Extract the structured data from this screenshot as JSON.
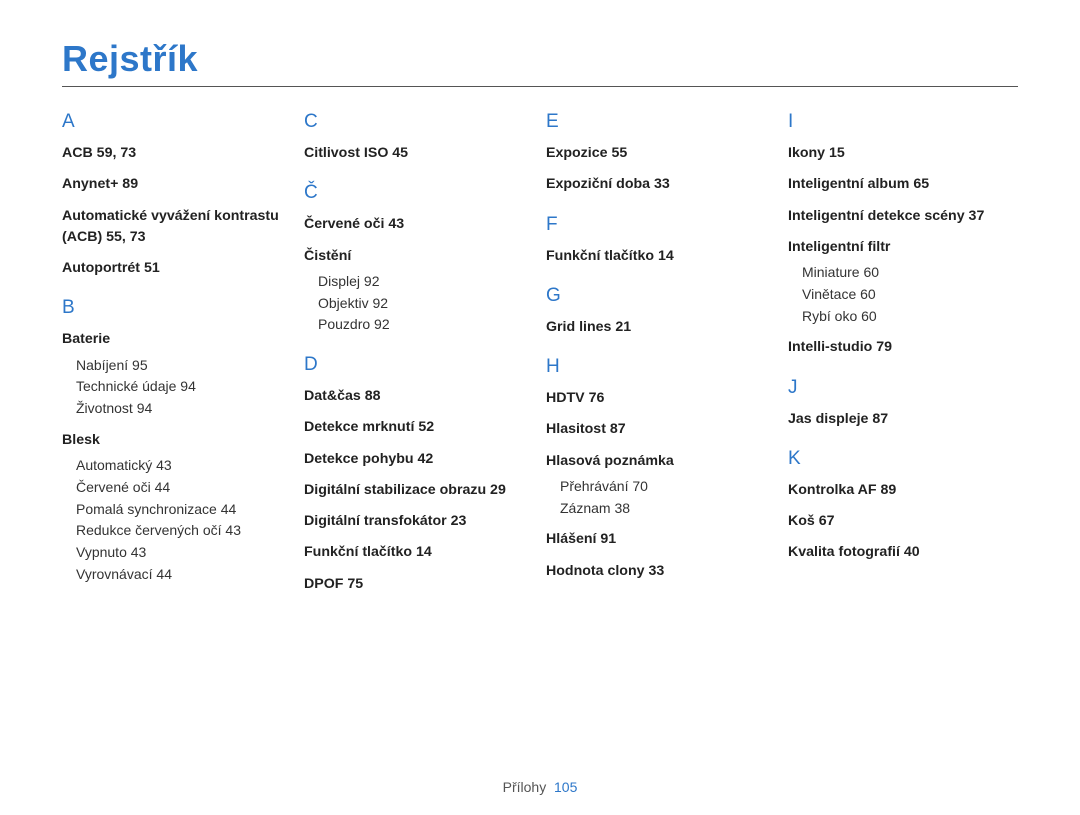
{
  "title": "Rejstřík",
  "footer": {
    "label": "Přílohy",
    "page": "105"
  },
  "col1": {
    "A": {
      "letter": "A",
      "e1": "ACB  59, 73",
      "e2": "Anynet+  89",
      "e3": "Automatické vyvážení kontrastu (ACB)  55, 73",
      "e4": "Autoportrét  51"
    },
    "B": {
      "letter": "B",
      "e1": "Baterie",
      "e1s1": "Nabíjení  95",
      "e1s2": "Technické údaje  94",
      "e1s3": "Životnost  94",
      "e2": "Blesk",
      "e2s1": "Automatický 43",
      "e2s2": "Červené oči 44",
      "e2s3": "Pomalá synchronizace 44",
      "e2s4": "Redukce červených očí 43",
      "e2s5": "Vypnuto 43",
      "e2s6": "Vyrovnávací 44"
    }
  },
  "col2": {
    "C": {
      "letter": "C",
      "e1": "Citlivost ISO  45"
    },
    "Cv": {
      "letter": "Č",
      "e1": "Červené oči  43",
      "e2": "Čistění",
      "e2s1": "Displej  92",
      "e2s2": "Objektiv  92",
      "e2s3": "Pouzdro  92"
    },
    "D": {
      "letter": "D",
      "e1": "Dat&čas  88",
      "e2": "Detekce mrknutí  52",
      "e3": "Detekce pohybu  42",
      "e4": "Digitální stabilizace obrazu  29",
      "e5": "Digitální transfokátor  23",
      "e6": "Funkční tlačítko 14",
      "e7": "DPOF  75"
    }
  },
  "col3": {
    "E": {
      "letter": "E",
      "e1": "Expozice  55",
      "e2": "Expoziční doba  33"
    },
    "F": {
      "letter": "F",
      "e1": "Funkční tlačítko 14"
    },
    "G": {
      "letter": "G",
      "e1": "Grid lines  21"
    },
    "H": {
      "letter": "H",
      "e1": "HDTV  76",
      "e2": "Hlasitost  87",
      "e3": "Hlasová poznámka",
      "e3s1": "Přehrávání  70",
      "e3s2": "Záznam  38",
      "e4": "Hlášení  91",
      "e5": "Hodnota clony  33"
    }
  },
  "col4": {
    "I": {
      "letter": "I",
      "e1": "Ikony  15",
      "e2": "Inteligentní album  65",
      "e3": "Inteligentní detekce scény  37",
      "e4": "Inteligentní filtr",
      "e4s1": "Miniature 60",
      "e4s2": "Vinětace 60",
      "e4s3": "Rybí oko 60",
      "e5": "Intelli-studio  79"
    },
    "J": {
      "letter": "J",
      "e1": "Jas displeje  87"
    },
    "K": {
      "letter": "K",
      "e1": "Kontrolka AF  89",
      "e2": "Koš  67",
      "e3": "Kvalita fotografií  40"
    }
  }
}
